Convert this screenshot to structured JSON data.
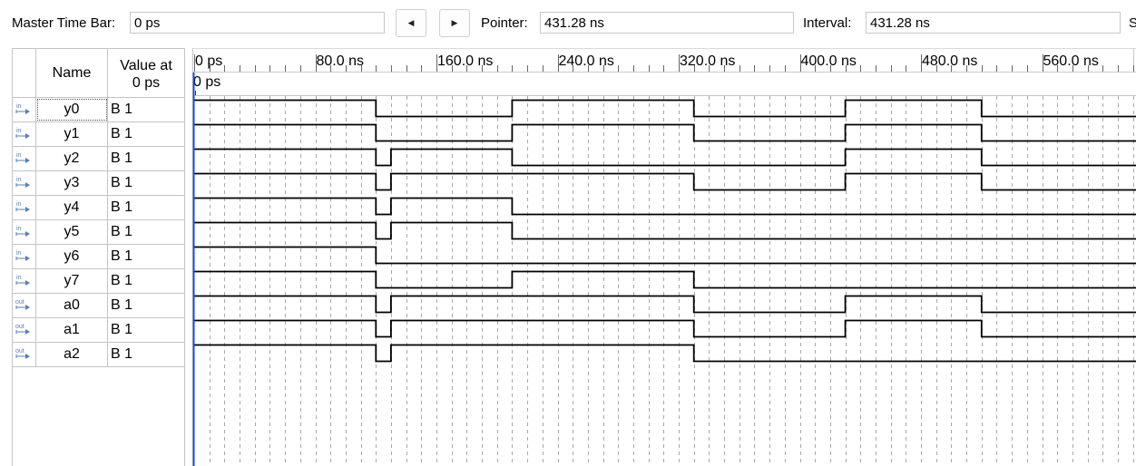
{
  "toolbar": {
    "master_label": "Master Time Bar:",
    "master_value": "0 ps",
    "prev_glyph": "◀",
    "next_glyph": "▶",
    "pointer_label": "Pointer:",
    "pointer_value": "431.28 ns",
    "interval_label": "Interval:",
    "interval_value": "431.28 ns",
    "cut_label": "S"
  },
  "table": {
    "name_header": "Name",
    "value_header_line1": "Value at",
    "value_header_line2": "0 ps"
  },
  "timeline": {
    "start_marker": "0 ps",
    "ticks": [
      "0 ps",
      "80.0 ns",
      "160.0 ns",
      "240.0 ns",
      "320.0 ns",
      "400.0 ns",
      "480.0 ns",
      "560.0 ns"
    ],
    "tick_values_ns": [
      0,
      80,
      160,
      240,
      320,
      400,
      480,
      560
    ],
    "transition_times_ns": [
      0,
      120,
      130,
      210,
      330,
      430,
      520
    ]
  },
  "signals": [
    {
      "name": "y0",
      "direction": "in",
      "icon": "input-pin-icon",
      "value": "B 1",
      "levels": [
        1,
        0,
        0,
        1,
        0,
        1,
        0
      ]
    },
    {
      "name": "y1",
      "direction": "in",
      "icon": "input-pin-icon",
      "value": "B 1",
      "levels": [
        1,
        0,
        0,
        1,
        0,
        1,
        0
      ]
    },
    {
      "name": "y2",
      "direction": "in",
      "icon": "input-pin-icon",
      "value": "B 1",
      "levels": [
        1,
        0,
        1,
        0,
        0,
        1,
        0
      ]
    },
    {
      "name": "y3",
      "direction": "in",
      "icon": "input-pin-icon",
      "value": "B 1",
      "levels": [
        1,
        0,
        1,
        1,
        0,
        1,
        0
      ]
    },
    {
      "name": "y4",
      "direction": "in",
      "icon": "input-pin-icon",
      "value": "B 1",
      "levels": [
        1,
        0,
        1,
        0,
        0,
        0,
        0
      ]
    },
    {
      "name": "y5",
      "direction": "in",
      "icon": "input-pin-icon",
      "value": "B 1",
      "levels": [
        1,
        0,
        1,
        0,
        0,
        0,
        0
      ]
    },
    {
      "name": "y6",
      "direction": "in",
      "icon": "input-pin-icon",
      "value": "B 1",
      "levels": [
        1,
        0,
        0,
        0,
        0,
        0,
        0
      ]
    },
    {
      "name": "y7",
      "direction": "in",
      "icon": "input-pin-icon",
      "value": "B 1",
      "levels": [
        1,
        0,
        0,
        1,
        0,
        0,
        0
      ]
    },
    {
      "name": "a0",
      "direction": "out",
      "icon": "output-pin-icon",
      "value": "B 1",
      "levels": [
        1,
        0,
        1,
        1,
        0,
        1,
        0
      ]
    },
    {
      "name": "a1",
      "direction": "out",
      "icon": "output-pin-icon",
      "value": "B 1",
      "levels": [
        1,
        0,
        1,
        1,
        0,
        1,
        0
      ]
    },
    {
      "name": "a2",
      "direction": "out",
      "icon": "output-pin-icon",
      "value": "B 1",
      "levels": [
        1,
        0,
        1,
        1,
        0,
        0,
        0
      ]
    }
  ],
  "colors": {
    "cursor": "#1f4fd6",
    "grid": "#a8a8a8",
    "icon": "#5b7fb0"
  }
}
